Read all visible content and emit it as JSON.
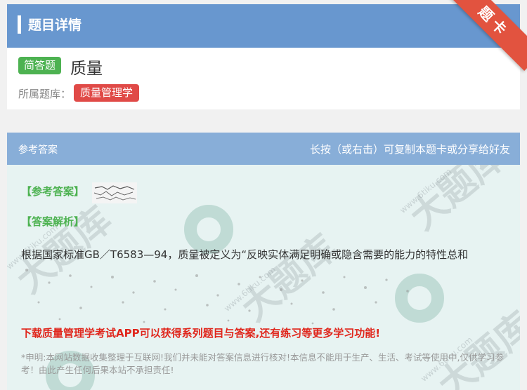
{
  "header": {
    "title": "题目详情",
    "ribbon": "题卡"
  },
  "question": {
    "type_tag": "简答题",
    "title": "质量",
    "bank_label": "所属题库：",
    "bank_tag": "质量管理学"
  },
  "answer_header": {
    "left": "参考答案",
    "right": "长按（或右击）可复制本题卡或分享给好友"
  },
  "answer": {
    "ref_label": "【参考答案】",
    "analysis_label": "【答案解析】",
    "analysis_text": "根据国家标准GB／T6583—94，质量被定义为“反映实体满足明确或隐含需要的能力的特性总和"
  },
  "promo": "下载质量管理学考试APP可以获得系列题目与答案,还有练习等更多学习功能!",
  "disclaimer": "*申明:本网站数据收集整理于互联网!我们并未能对答案信息进行核对!本信息不能用于生产、生活、考试等使用中,仅供学习参考！由此产生任何后果本站不承担责任!",
  "watermark": {
    "big": "大题库",
    "small": "www.6tiku.com"
  },
  "colors": {
    "header": "#6897cf",
    "answer_header": "#88aed8",
    "answer_bg": "#e7f3f2",
    "type_tag": "#4db251",
    "bank_tag": "#e04a47",
    "promo": "#e0261c"
  }
}
